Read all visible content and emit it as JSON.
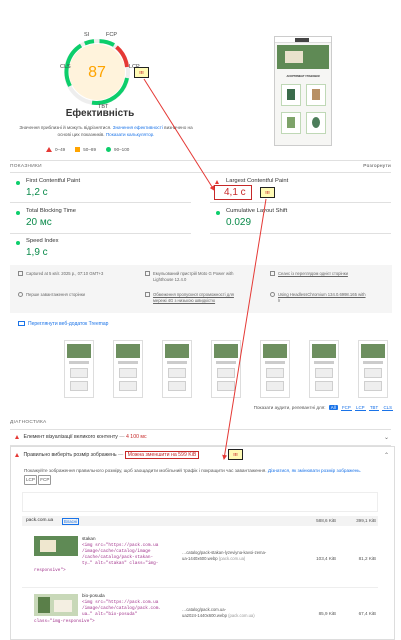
{
  "gauge": {
    "score": "87",
    "title": "Ефективність",
    "labels": {
      "si": "SI",
      "fcp": "FCP",
      "cls": "CLS",
      "lcp": "LCP",
      "tbt": "TBT"
    },
    "score_color": "#ffa400",
    "ring_bg": "#fff3dc"
  },
  "note": {
    "text1": "Значення приблизні й можуть відрізнятися.",
    "link1": "Значення ефективності",
    "text2": "визначено на основі цих показників.",
    "link2": "Показати калькулятор."
  },
  "legend": {
    "bad": "0–49",
    "avg": "50–89",
    "good": "90–100"
  },
  "phone": {
    "heading": "АСОРТИМЕНТ УПАКОВКИ"
  },
  "metrics_header": {
    "title": "ПОКАЗНИКИ",
    "toggle": "Розгорнути"
  },
  "metrics": [
    {
      "label": "First Contentful Paint",
      "value": "1,2 с",
      "status": "good"
    },
    {
      "label": "Largest Contentful Paint",
      "value": "4,1 с",
      "status": "bad"
    },
    {
      "label": "Total Blocking Time",
      "value": "20 мс",
      "status": "good"
    },
    {
      "label": "Cumulative Layout Shift",
      "value": "0.029",
      "status": "good"
    },
    {
      "label": "Speed Index",
      "value": "1,9 с",
      "status": "good"
    }
  ],
  "info": {
    "captured": "Captured at 5 квіт. 2025 р., 07:10 GMT+3",
    "emulated": "Емульований пристрій Moto G Power with",
    "lighthouse": "Lighthouse 12.4.0",
    "single": "Сеанс із переглядом однієї сторінки",
    "first_load": "Перше завантаження сторінки",
    "throttle1": "Обмеження пропускної спроможності для",
    "throttle2": "мережі 4G з низькою швидкістю",
    "browser1": "Using HeadlessChromium 134.0.6998.165 with",
    "browser2": "lr"
  },
  "treemap": {
    "label": "Переглянути веб-додаток Treemap"
  },
  "filter": {
    "label": "Показати аудити, релевантні для:",
    "options": [
      "All",
      "FCP",
      "LCP",
      "TBT",
      "CLS"
    ]
  },
  "diagnostics": {
    "title": "ДІАГНОСТИКА"
  },
  "audit1": {
    "title": "Елемент візуалізації великого контенту",
    "dash": "—",
    "value": "4 100 мс"
  },
  "audit2": {
    "title": "Правильно виберіть розмір зображень",
    "dash": "—",
    "value": "Можна зменшити на 599 KiB",
    "desc": "Покажуйте зображення правильного розміру, щоб заощадити мобільний трафік і покращити час завантаження.",
    "link": "Дізнатися, як змінювати розмір зображень.",
    "tags": [
      "LCP",
      "FCP"
    ]
  },
  "table": {
    "domain": "pack.com.ua",
    "badge": "Власні",
    "total1": "588,6 KiB",
    "total2": "399,1 KiB",
    "rows": [
      {
        "name": "stakan",
        "code1": "<img src=\"https://pack.com.ua",
        "code2": "/image/cache/catalog/image",
        "code3": "/cache/catalog/pack-stakan-",
        "code4": "ty…\" alt=\"stakan\" class=\"img-",
        "code5": "responsive\">",
        "url": "…catalog/pack-stakan-lyzeviyna-kavoi-zema-",
        "url2": "ua-1440x600.webp",
        "host": "(pack.com.ua)",
        "size": "103,4 KiB",
        "save": "81,2 KiB"
      },
      {
        "name": "bio-posuda",
        "code1": "<img src=\"https://pack.com.ua",
        "code2": "/image/cache/catalog/pack.com.",
        "code3": "ua…\" alt=\"bio-posuda\"",
        "code4": "class=\"img-responsive\">",
        "code5": "",
        "url": "…catalog/pack.com.ua-",
        "url2": "ua2024-1440x600.webp",
        "host": "(pack.com.ua)",
        "size": "85,9 KiB",
        "save": "67,4 KiB"
      }
    ]
  },
  "callout": {
    "text": "!!!"
  },
  "colors": {
    "good": "#0cce6b",
    "bad": "#e53935",
    "avg": "#ffa400",
    "arrow": "#e53935",
    "link": "#1a73e8"
  }
}
